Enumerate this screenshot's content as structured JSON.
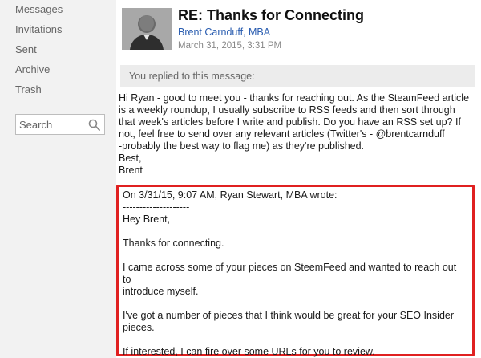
{
  "sidebar": {
    "items": [
      {
        "label": "Messages"
      },
      {
        "label": "Invitations"
      },
      {
        "label": "Sent"
      },
      {
        "label": "Archive"
      },
      {
        "label": "Trash"
      }
    ],
    "search": {
      "placeholder": "Search",
      "icon": "search-icon"
    }
  },
  "message": {
    "subject": "RE: Thanks for Connecting",
    "sender": "Brent Carnduff, MBA",
    "date": "March 31, 2015, 3:31 PM",
    "replied_notice": "You replied to this message:",
    "body": [
      "Hi Ryan - good to meet you - thanks for reaching out. As the SteamFeed article",
      "is a weekly roundup, I usually subscribe to RSS feeds and then sort through",
      "that week's articles before I write and publish. Do you have an RSS set up? If",
      "not, feel free to send over any relevant articles (Twitter's - @brentcarnduff",
      "-probably the best way to flag me) as they're published.",
      "Best,",
      "Brent"
    ],
    "quote": {
      "header": "On 3/31/15, 9:07 AM, Ryan Stewart, MBA wrote:",
      "separator": "--------------------",
      "greeting": "Hey Brent,",
      "p1": "Thanks for connecting.",
      "p2a": "I came across some of your pieces on SteemFeed and wanted to reach out to",
      "p2b": "introduce myself.",
      "p3a": "I've got a number of pieces that I think would be great for your SEO Insider",
      "p3b": "pieces.",
      "p4": "If interested, I can fire over some URLs for you to review."
    }
  },
  "colors": {
    "highlight_border": "#e02020",
    "link": "#2a5db0",
    "sidebar_bg": "#f2f2f2"
  }
}
